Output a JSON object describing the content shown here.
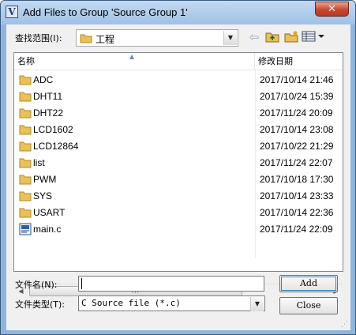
{
  "window": {
    "title": "Add Files to Group 'Source Group 1'",
    "close_glyph": "✕"
  },
  "toolbar": {
    "lookin_label": "查找范围(I):",
    "lookin_value": "工程",
    "back_glyph": "⇦"
  },
  "list": {
    "headers": {
      "name": "名称",
      "date": "修改日期"
    },
    "items": [
      {
        "name": "ADC",
        "date": "2017/10/14 21:46",
        "type": "folder"
      },
      {
        "name": "DHT11",
        "date": "2017/10/24 15:39",
        "type": "folder"
      },
      {
        "name": "DHT22",
        "date": "2017/11/24 20:09",
        "type": "folder"
      },
      {
        "name": "LCD1602",
        "date": "2017/10/14 23:08",
        "type": "folder"
      },
      {
        "name": "LCD12864",
        "date": "2017/10/22 21:29",
        "type": "folder"
      },
      {
        "name": "list",
        "date": "2017/11/24 22:07",
        "type": "folder"
      },
      {
        "name": "PWM",
        "date": "2017/10/18 17:30",
        "type": "folder"
      },
      {
        "name": "SYS",
        "date": "2017/10/14 23:33",
        "type": "folder"
      },
      {
        "name": "USART",
        "date": "2017/10/14 22:36",
        "type": "folder"
      },
      {
        "name": "main.c",
        "date": "2017/11/24 22:09",
        "type": "c-file"
      }
    ],
    "scroll_thumb_grip": "III"
  },
  "form": {
    "filename_label": "文件名(N):",
    "filename_value": "",
    "filetype_label": "文件类型(T):",
    "filetype_value": "C Source file (*.c)",
    "add_label": "Add",
    "close_label": "Close"
  },
  "colors": {
    "titlebar": "#9fc1e6",
    "close_button": "#c9462c",
    "folder": "#e8c15a",
    "selection_border": "#3c7fb1"
  }
}
